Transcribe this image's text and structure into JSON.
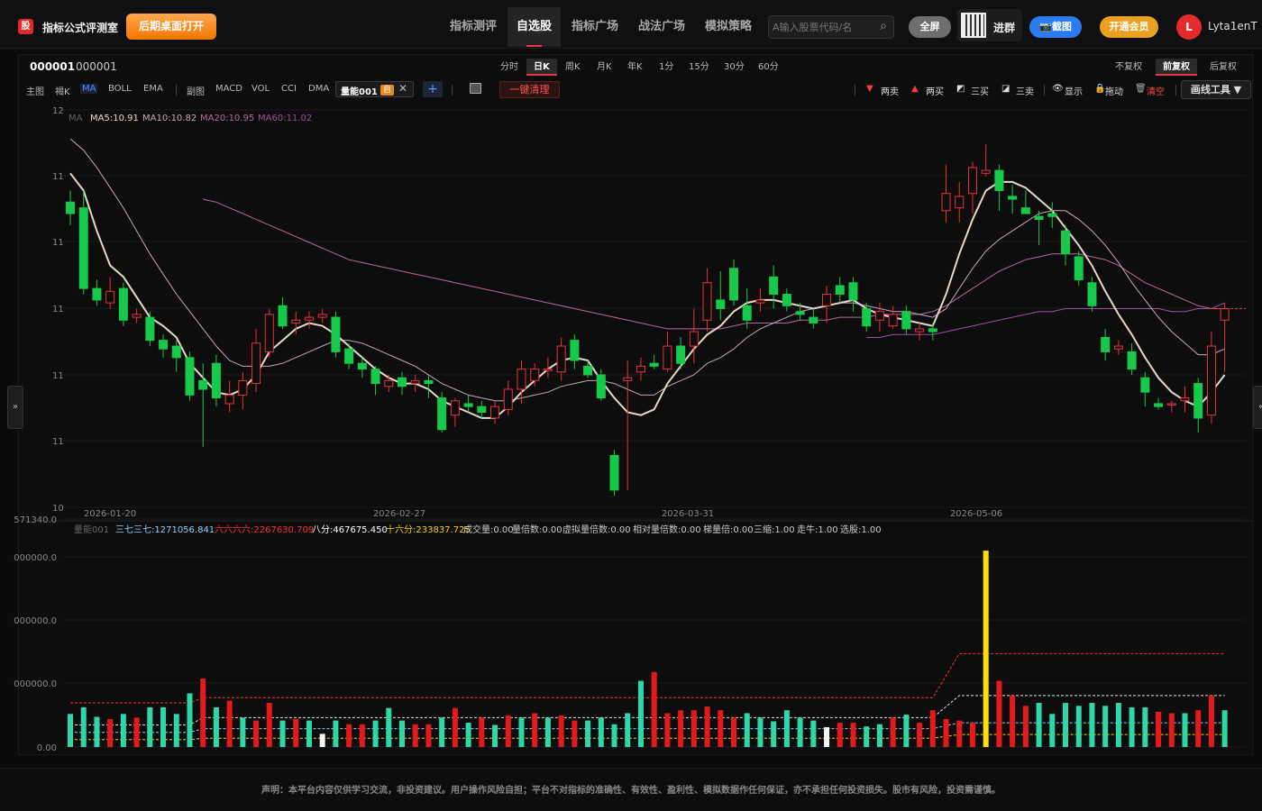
{
  "app": {
    "logo": "股",
    "title": "指标公式评测室",
    "desktop_btn": "后期桌面打开"
  },
  "nav": [
    "指标测评",
    "自选股",
    "指标广场",
    "战法广场",
    "模拟策略"
  ],
  "search": {
    "placeholder": "A输入股票代码/名"
  },
  "top_buttons": {
    "fullscreen": "全屏",
    "join": "进群",
    "screenshot": "📷截图",
    "vip": "开通会员"
  },
  "user": {
    "initial": "L",
    "name": "Lyta1enT"
  },
  "stock": {
    "code": "000001",
    "name": "000001"
  },
  "periods": [
    "分时",
    "日K",
    "周K",
    "月K",
    "年K",
    "1分",
    "15分",
    "30分",
    "60分"
  ],
  "rights": [
    "不复权",
    "前复权",
    "后复权"
  ],
  "indicators": [
    "主图",
    "褐K",
    "MA",
    "BOLL",
    "EMA",
    "副图",
    "MACD",
    "VOL",
    "CCI",
    "DMA"
  ],
  "custom_tag": {
    "name": "量能001",
    "badge": "自",
    "close": "✕"
  },
  "toolbar": {
    "add": "+",
    "clear": "一键清理",
    "sell2": "两卖",
    "buy2": "两买",
    "buy3": "三买",
    "sell3": "三卖",
    "show": "显示",
    "drag": "拖动",
    "clear_lines": "清空",
    "draw_tool": "画线工具 ▼"
  },
  "side": {
    "left": "»",
    "right": "«"
  },
  "ma_legend": {
    "label": "MA",
    "ma5": "MA5:10.91",
    "ma10": "MA10:10.82",
    "ma20": "MA20:10.95",
    "ma60": "MA60:11.02"
  },
  "sub_legend": {
    "name": "量能001",
    "items": [
      {
        "text": "三七三七:1271056.841",
        "color": "#8fd0ff"
      },
      {
        "text": "六六六六:2267630.709",
        "color": "#ff3030"
      },
      {
        "text": "八分:467675.450",
        "color": "#ffffff"
      },
      {
        "text": "十六分:233837.725",
        "color": "#ffd000"
      },
      {
        "text": "成交量:0.00",
        "color": "#cccccc"
      },
      {
        "text": "量倍数:0.00",
        "color": "#cccccc"
      },
      {
        "text": "虚拟量倍数:0.00",
        "color": "#cccccc"
      },
      {
        "text": "相对量倍数:0.00",
        "color": "#cccccc"
      },
      {
        "text": "梯量倍:0.00",
        "color": "#cccccc"
      },
      {
        "text": "三缩:1.00",
        "color": "#cccccc"
      },
      {
        "text": "走牛:1.00",
        "color": "#cccccc"
      },
      {
        "text": "选股:1.00",
        "color": "#cccccc"
      }
    ]
  },
  "footer": "声明：本平台内容仅供学习交流，非投资建议。用户操作风险自担；平台不对指标的准确性、有效性、盈利性、模拟数据作任何保证，亦不承担任何投资损失。股市有风险，投资需谨慎。",
  "colors": {
    "up": "#e8313a",
    "down": "#17c94b",
    "vol_up": "#e21a1a",
    "vol_down": "#2fd6a6",
    "ma5": "#e8d8c8",
    "ma10": "#c8a8b8",
    "ma20": "#b86a98",
    "ma60": "#a050a0"
  },
  "chart_data": [
    {
      "type": "candlestick",
      "y_tick_labels": [
        "12",
        "11",
        "11",
        "11",
        "11",
        "11",
        "10"
      ],
      "x_tick_labels": [
        "2026-01-20",
        "2026-02-27",
        "2026-03-31",
        "2026-05-06"
      ],
      "candles": [
        [
          11.3,
          11.26,
          11.34,
          11.22
        ],
        [
          11.28,
          11.0,
          11.34,
          10.98
        ],
        [
          11.0,
          10.96,
          11.03,
          10.94
        ],
        [
          10.95,
          10.99,
          11.04,
          10.93
        ],
        [
          11.0,
          10.89,
          11.02,
          10.87
        ],
        [
          10.9,
          10.91,
          10.93,
          10.88
        ],
        [
          10.9,
          10.82,
          10.92,
          10.8
        ],
        [
          10.82,
          10.79,
          10.84,
          10.76
        ],
        [
          10.8,
          10.76,
          10.82,
          10.71
        ],
        [
          10.76,
          10.63,
          10.78,
          10.61
        ],
        [
          10.68,
          10.65,
          10.74,
          10.45
        ],
        [
          10.74,
          10.62,
          10.77,
          10.59
        ],
        [
          10.6,
          10.63,
          10.68,
          10.57
        ],
        [
          10.63,
          10.68,
          10.71,
          10.58
        ],
        [
          10.67,
          10.81,
          10.86,
          10.64
        ],
        [
          10.78,
          10.91,
          10.93,
          10.76
        ],
        [
          10.94,
          10.87,
          10.97,
          10.86
        ],
        [
          10.88,
          10.89,
          10.92,
          10.84
        ],
        [
          10.89,
          10.9,
          10.92,
          10.86
        ],
        [
          10.9,
          10.91,
          10.93,
          10.88
        ],
        [
          10.9,
          10.78,
          10.92,
          10.76
        ],
        [
          10.79,
          10.74,
          10.81,
          10.72
        ],
        [
          10.74,
          10.72,
          10.76,
          10.69
        ],
        [
          10.72,
          10.67,
          10.73,
          10.63
        ],
        [
          10.66,
          10.68,
          10.7,
          10.64
        ],
        [
          10.69,
          10.66,
          10.71,
          10.63
        ],
        [
          10.67,
          10.68,
          10.7,
          10.64
        ],
        [
          10.68,
          10.67,
          10.7,
          10.62
        ],
        [
          10.62,
          10.51,
          10.64,
          10.5
        ],
        [
          10.56,
          10.61,
          10.62,
          10.52
        ],
        [
          10.6,
          10.59,
          10.63,
          10.57
        ],
        [
          10.59,
          10.57,
          10.61,
          10.55
        ],
        [
          10.55,
          10.59,
          10.61,
          10.53
        ],
        [
          10.58,
          10.65,
          10.68,
          10.56
        ],
        [
          10.65,
          10.72,
          10.75,
          10.6
        ],
        [
          10.68,
          10.72,
          10.74,
          10.66
        ],
        [
          10.72,
          10.72,
          10.76,
          10.69
        ],
        [
          10.71,
          10.8,
          10.83,
          10.68
        ],
        [
          10.82,
          10.75,
          10.84,
          10.72
        ],
        [
          10.73,
          10.7,
          10.75,
          10.69
        ],
        [
          10.7,
          10.62,
          10.72,
          10.61
        ],
        [
          10.42,
          10.3,
          10.44,
          10.28
        ],
        [
          10.68,
          10.69,
          10.75,
          10.3
        ],
        [
          10.71,
          10.73,
          10.76,
          10.68
        ],
        [
          10.74,
          10.73,
          10.77,
          10.72
        ],
        [
          10.72,
          10.8,
          10.85,
          10.71
        ],
        [
          10.8,
          10.74,
          10.83,
          10.72
        ],
        [
          10.8,
          10.85,
          10.93,
          10.74
        ],
        [
          10.89,
          11.02,
          11.07,
          10.85
        ],
        [
          10.96,
          10.93,
          11.06,
          10.89
        ],
        [
          11.07,
          10.96,
          11.1,
          10.94
        ],
        [
          10.94,
          10.89,
          11.0,
          10.86
        ],
        [
          10.95,
          10.96,
          11.0,
          10.92
        ],
        [
          11.04,
          10.98,
          11.08,
          10.93
        ],
        [
          10.98,
          10.94,
          11.0,
          10.92
        ],
        [
          10.92,
          10.91,
          10.95,
          10.89
        ],
        [
          10.9,
          10.88,
          10.93,
          10.86
        ],
        [
          10.94,
          10.98,
          11.01,
          10.88
        ],
        [
          11.01,
          10.98,
          11.04,
          10.95
        ],
        [
          11.02,
          10.96,
          11.04,
          10.92
        ],
        [
          10.93,
          10.87,
          10.95,
          10.85
        ],
        [
          10.89,
          10.92,
          10.95,
          10.85
        ],
        [
          10.87,
          10.91,
          10.94,
          10.86
        ],
        [
          10.92,
          10.86,
          10.94,
          10.84
        ],
        [
          10.85,
          10.86,
          10.88,
          10.82
        ],
        [
          10.86,
          10.85,
          10.88,
          10.82
        ],
        [
          11.27,
          11.33,
          11.43,
          11.23
        ],
        [
          11.28,
          11.32,
          11.37,
          11.23
        ],
        [
          11.33,
          11.42,
          11.44,
          11.26
        ],
        [
          11.4,
          11.41,
          11.5,
          11.39
        ],
        [
          11.41,
          11.34,
          11.43,
          11.27
        ],
        [
          11.32,
          11.31,
          11.36,
          11.26
        ],
        [
          11.28,
          11.26,
          11.34,
          11.26
        ],
        [
          11.25,
          11.24,
          11.27,
          11.15
        ],
        [
          11.26,
          11.25,
          11.3,
          11.21
        ],
        [
          11.2,
          11.12,
          11.22,
          11.08
        ],
        [
          11.11,
          11.03,
          11.13,
          11.01
        ],
        [
          11.02,
          10.94,
          11.04,
          10.92
        ],
        [
          10.83,
          10.78,
          10.86,
          10.75
        ],
        [
          10.79,
          10.8,
          10.82,
          10.77
        ],
        [
          10.78,
          10.72,
          10.81,
          10.7
        ],
        [
          10.69,
          10.64,
          10.71,
          10.59
        ],
        [
          10.6,
          10.59,
          10.62,
          10.58
        ],
        [
          10.6,
          10.6,
          10.61,
          10.57
        ],
        [
          10.61,
          10.62,
          10.66,
          10.57
        ],
        [
          10.67,
          10.55,
          10.69,
          10.5
        ],
        [
          10.56,
          10.8,
          10.85,
          10.53
        ],
        [
          10.89,
          10.93,
          10.95,
          10.71
        ]
      ],
      "ma5": [
        11.4,
        11.34,
        11.2,
        11.08,
        11.04,
        10.97,
        10.9,
        10.87,
        10.83,
        10.74,
        10.69,
        10.64,
        10.63,
        10.65,
        10.7,
        10.78,
        10.82,
        10.86,
        10.88,
        10.87,
        10.84,
        10.8,
        10.76,
        10.72,
        10.69,
        10.67,
        10.67,
        10.65,
        10.61,
        10.59,
        10.57,
        10.55,
        10.55,
        10.59,
        10.64,
        10.68,
        10.72,
        10.75,
        10.76,
        10.75,
        10.68,
        10.62,
        10.57,
        10.56,
        10.58,
        10.67,
        10.73,
        10.79,
        10.84,
        10.87,
        10.92,
        10.95,
        10.96,
        10.96,
        10.95,
        10.94,
        10.93,
        10.94,
        10.95,
        10.96,
        10.93,
        10.91,
        10.9,
        10.89,
        10.88,
        10.87,
        10.98,
        11.12,
        11.24,
        11.34,
        11.37,
        11.37,
        11.35,
        11.31,
        11.27,
        11.21,
        11.15,
        11.08,
        10.99,
        10.91,
        10.84,
        10.76,
        10.69,
        10.64,
        10.61,
        10.59,
        10.64,
        10.7
      ],
      "ma10": [
        11.52,
        11.48,
        11.42,
        11.35,
        11.28,
        11.2,
        11.12,
        11.05,
        10.98,
        10.92,
        10.86,
        10.8,
        10.75,
        10.73,
        10.73,
        10.73,
        10.74,
        10.76,
        10.78,
        10.8,
        10.82,
        10.82,
        10.81,
        10.79,
        10.77,
        10.75,
        10.73,
        10.7,
        10.67,
        10.65,
        10.63,
        10.62,
        10.61,
        10.61,
        10.62,
        10.63,
        10.64,
        10.66,
        10.67,
        10.68,
        10.68,
        10.67,
        10.65,
        10.63,
        10.63,
        10.66,
        10.68,
        10.7,
        10.74,
        10.76,
        10.79,
        10.83,
        10.86,
        10.88,
        10.9,
        10.92,
        10.93,
        10.94,
        10.95,
        10.95,
        10.94,
        10.93,
        10.92,
        10.92,
        10.91,
        10.9,
        10.93,
        11.0,
        11.07,
        11.13,
        11.17,
        11.2,
        11.23,
        11.26,
        11.27,
        11.27,
        11.24,
        11.2,
        11.15,
        11.09,
        11.02,
        10.96,
        10.9,
        10.85,
        10.81,
        10.77,
        10.77,
        10.79
      ],
      "ma20": [
        null,
        null,
        null,
        null,
        null,
        null,
        null,
        null,
        null,
        null,
        11.31,
        11.3,
        11.28,
        11.26,
        11.24,
        11.22,
        11.2,
        11.18,
        11.16,
        11.14,
        11.12,
        11.1,
        11.09,
        11.08,
        11.07,
        11.06,
        11.05,
        11.04,
        11.03,
        11.02,
        11.01,
        11.0,
        10.99,
        10.98,
        10.97,
        10.96,
        10.95,
        10.94,
        10.93,
        10.92,
        10.91,
        10.9,
        10.89,
        10.88,
        10.87,
        10.86,
        10.86,
        10.86,
        10.86,
        10.86,
        10.87,
        10.88,
        10.88,
        10.88,
        10.88,
        10.89,
        10.89,
        10.89,
        10.9,
        10.9,
        10.9,
        10.91,
        10.91,
        10.91,
        10.91,
        10.92,
        10.94,
        10.97,
        11.0,
        11.03,
        11.06,
        11.08,
        11.1,
        11.11,
        11.12,
        11.12,
        11.12,
        11.11,
        11.1,
        11.08,
        11.05,
        11.02,
        11.0,
        10.98,
        10.96,
        10.94,
        10.93,
        10.93
      ],
      "ma60": [
        null,
        null,
        null,
        null,
        null,
        null,
        null,
        null,
        null,
        null,
        null,
        null,
        null,
        null,
        null,
        null,
        null,
        null,
        null,
        null,
        null,
        null,
        null,
        null,
        null,
        null,
        null,
        null,
        null,
        null,
        null,
        null,
        null,
        null,
        null,
        null,
        null,
        null,
        null,
        null,
        null,
        null,
        null,
        null,
        null,
        null,
        null,
        null,
        null,
        null,
        null,
        null,
        null,
        null,
        null,
        null,
        null,
        null,
        null,
        null,
        10.83,
        10.83,
        10.84,
        10.84,
        10.84,
        10.84,
        10.85,
        10.86,
        10.87,
        10.88,
        10.89,
        10.9,
        10.91,
        10.92,
        10.92,
        10.93,
        10.93,
        10.93,
        10.93,
        10.93,
        10.93,
        10.93,
        10.93,
        10.92,
        10.92,
        10.93,
        10.93,
        10.95
      ]
    },
    {
      "type": "bar",
      "y_tick_labels": [
        "571340.0",
        "000000.0",
        "000000.0",
        "000000.0",
        "0.00"
      ],
      "volume": [
        0.45,
        0.54,
        0.41,
        0.38,
        0.45,
        0.4,
        0.54,
        0.54,
        0.45,
        0.73,
        0.93,
        0.54,
        0.63,
        0.4,
        0.36,
        0.6,
        0.36,
        0.38,
        0.36,
        0.18,
        0.36,
        0.31,
        0.31,
        0.36,
        0.53,
        0.36,
        0.31,
        0.31,
        0.4,
        0.53,
        0.33,
        0.4,
        0.3,
        0.43,
        0.4,
        0.46,
        0.4,
        0.43,
        0.36,
        0.36,
        0.4,
        0.31,
        0.46,
        0.9,
        1.02,
        0.46,
        0.5,
        0.5,
        0.55,
        0.5,
        0.4,
        0.46,
        0.4,
        0.35,
        0.5,
        0.4,
        0.36,
        0.27,
        0.33,
        0.33,
        0.28,
        0.31,
        0.4,
        0.44,
        0.33,
        0.5,
        0.38,
        0.36,
        0.33,
        2.67,
        0.9,
        0.7,
        0.56,
        0.6,
        0.45,
        0.6,
        0.56,
        0.6,
        0.56,
        0.6,
        0.54,
        0.54,
        0.48,
        0.46,
        0.46,
        0.5,
        0.7,
        0.5
      ],
      "vol_kind": [
        "d",
        "d",
        "d",
        "u",
        "d",
        "u",
        "d",
        "d",
        "d",
        "d",
        "u",
        "d",
        "u",
        "d",
        "u",
        "u",
        "d",
        "u",
        "d",
        "w",
        "d",
        "u",
        "u",
        "d",
        "d",
        "d",
        "u",
        "u",
        "d",
        "u",
        "d",
        "u",
        "d",
        "u",
        "d",
        "u",
        "d",
        "u",
        "u",
        "d",
        "d",
        "d",
        "d",
        "d",
        "u",
        "u",
        "u",
        "u",
        "u",
        "u",
        "u",
        "d",
        "d",
        "d",
        "d",
        "d",
        "d",
        "w",
        "u",
        "u",
        "d",
        "d",
        "u",
        "d",
        "u",
        "u",
        "u",
        "u",
        "u",
        "y",
        "u",
        "u",
        "u",
        "d",
        "d",
        "d",
        "d",
        "d",
        "d",
        "d",
        "d",
        "d",
        "u",
        "u",
        "d",
        "u",
        "u",
        "d"
      ]
    }
  ]
}
